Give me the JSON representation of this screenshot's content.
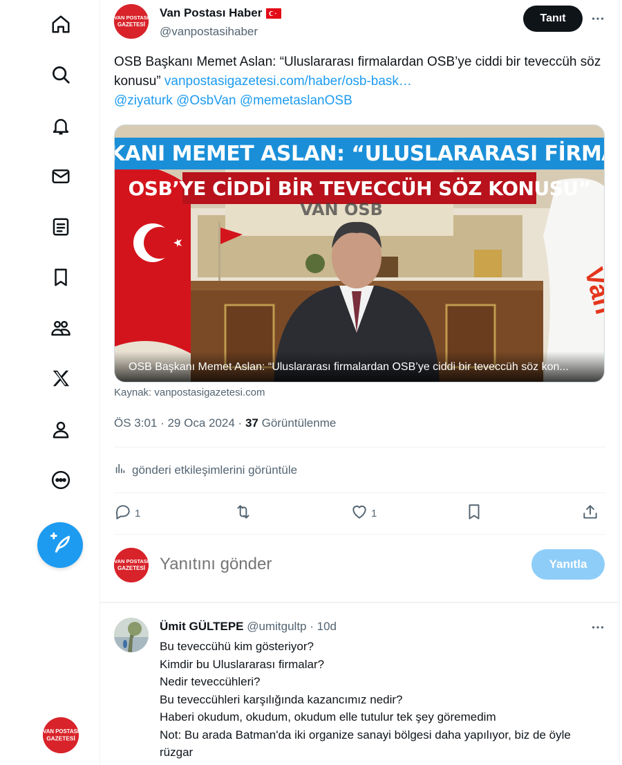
{
  "colors": {
    "accent": "#1d9bf0",
    "text": "#0f1419",
    "muted": "#536471",
    "brand_red": "#d8232a"
  },
  "nav": {
    "items": [
      {
        "name": "home-icon"
      },
      {
        "name": "search-icon"
      },
      {
        "name": "bell-icon"
      },
      {
        "name": "mail-icon"
      },
      {
        "name": "list-icon"
      },
      {
        "name": "bookmark-icon"
      },
      {
        "name": "communities-icon"
      },
      {
        "name": "x-logo-icon"
      },
      {
        "name": "profile-icon"
      },
      {
        "name": "more-circle-icon"
      }
    ],
    "compose_icon": "compose-icon"
  },
  "brand_logo": {
    "line1": "VAN POSTASI",
    "line2": "GAZETESİ"
  },
  "post": {
    "author_name": "Van Postası Haber",
    "author_handle": "@vanpostasihaber",
    "follow_label": "Tanıt",
    "text": "OSB Başkanı Memet Aslan: “Uluslararası firmalardan OSB’ye ciddi bir teveccüh söz konusu”",
    "link": "vanpostasigazetesi.com/haber/osb-bask…",
    "mentions": "@ziyaturk @OsbVan @memetaslanOSB",
    "media": {
      "banner_line1": "OSB BAŞKANI MEMET ASLAN: “ULUSLARARASI FİRMALARDAN",
      "banner_line2": "OSB’YE CİDDİ BİR TEVECCÜH SÖZ KONUSU”",
      "sign": "VAN OSB",
      "caption": "OSB Başkanı Memet Aslan: “Uluslararası firmalardan OSB’ye ciddi bir teveccüh söz kon..."
    },
    "source": "Kaynak: vanpostasigazetesi.com",
    "time": "ÖS 3:01 · 29 Oca 2024 · ",
    "views_count": "37",
    "views_label": " Görüntülenme",
    "activity_label": "gönderi etkileşimlerini görüntüle",
    "actions": {
      "reply_count": "1",
      "like_count": "1"
    }
  },
  "reply_box": {
    "placeholder": "Yanıtını gönder",
    "button_label": "Yanıtla"
  },
  "comment": {
    "name": "Ümit GÜLTEPE",
    "handle": "@umitgultp · 10d",
    "lines": [
      "Bu teveccühü kim gösteriyor?",
      "Kimdir bu Uluslararası firmalar?",
      "Nedir teveccühleri?",
      "Bu teveccühleri karşılığında kazancımız nedir?",
      "Haberi okudum, okudum, okudum elle tutulur tek şey göremedim",
      "Not: Bu arada Batman'da iki organize sanayi bölgesi daha yapılıyor, biz de öyle rüzgar"
    ]
  }
}
